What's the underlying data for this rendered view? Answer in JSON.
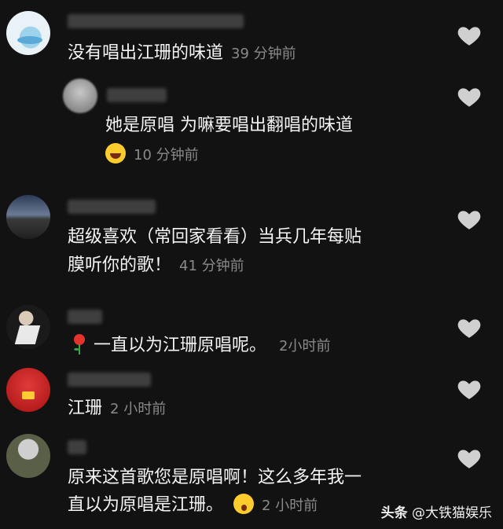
{
  "comments": [
    {
      "text": "没有唱出江珊的味道",
      "time": "39 分钟前"
    },
    {
      "text": "她是原唱 为嘛要唱出翻唱的味道",
      "time": "10 分钟前",
      "emoji": "laughing-tears-emoji"
    },
    {
      "line1": "超级喜欢（常回家看看）当兵几年每贴",
      "line2": "膜听你的歌！",
      "time": "41 分钟前"
    },
    {
      "text": "一直以为江珊原唱呢。",
      "time": "2小时前",
      "emoji": "rose-emoji"
    },
    {
      "text": "江珊",
      "time": "2 小时前"
    },
    {
      "line1": "原来这首歌您是原唱啊！这么多年我一",
      "line2": "直以为原唱是江珊。",
      "time": "2 小时前",
      "emoji": "shocked-emoji"
    }
  ],
  "watermark": {
    "brand": "头条",
    "handle": "@大铁猫娱乐"
  }
}
